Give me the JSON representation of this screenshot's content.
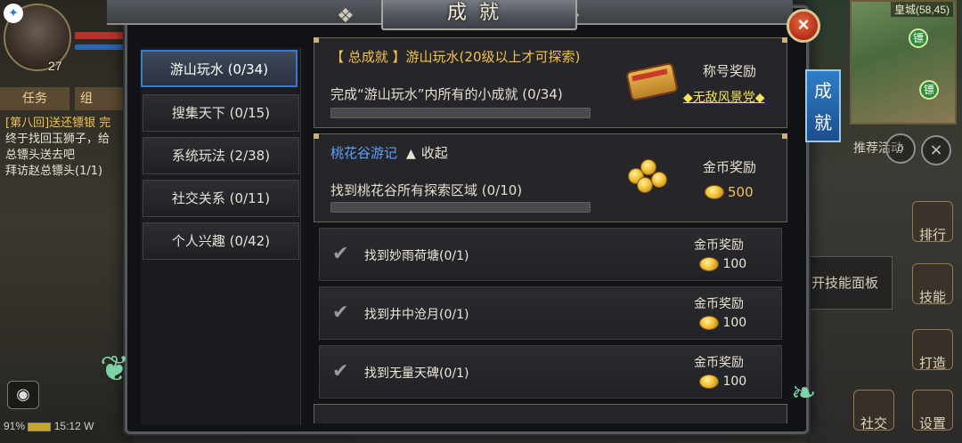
{
  "hud": {
    "level": "27",
    "notif_icon": "bird-badge-icon",
    "tabs": [
      "任务",
      "组"
    ],
    "quest_log": {
      "title": "[第八回]送还镖银 完",
      "lines": [
        "终于找回玉狮子，给",
        "总镖头送去吧",
        "拜访赵总镖头(1/1)"
      ]
    },
    "status": {
      "battery": "91%",
      "time": "15:12",
      "signal": "W"
    },
    "map_coords": "皇城(58,45)",
    "map_markers": [
      "镖",
      "镖"
    ],
    "recommend": "推荐活动",
    "side_buttons": [
      "排行",
      "技能",
      "打造",
      "社交",
      "设置"
    ],
    "skill_panel": "开技能面板"
  },
  "panel": {
    "title": "成就",
    "close_label": "×",
    "side_tab": "成就",
    "categories": [
      {
        "label": "游山玩水 (0/34)",
        "active": true
      },
      {
        "label": "搜集天下 (0/15)",
        "active": false
      },
      {
        "label": "系统玩法 (2/38)",
        "active": false
      },
      {
        "label": "社交关系 (0/11)",
        "active": false
      },
      {
        "label": "个人兴趣 (0/42)",
        "active": false
      }
    ],
    "total_card": {
      "tag": "【 总成就 】",
      "title": "游山玩水(20级以上才可探索)",
      "desc": "完成“游山玩水”内所有的小成就 (0/34)",
      "progress": 0,
      "reward_label": "称号奖励",
      "reward_title": "◆无敌风景党◆"
    },
    "group_card": {
      "name": "桃花谷游记",
      "collapse": "收起",
      "desc": "找到桃花谷所有探索区域 (0/10)",
      "progress": 0,
      "reward_label": "金币奖励",
      "reward_value": "500"
    },
    "rows": [
      {
        "name": "找到妙雨荷塘(0/1)",
        "reward_label": "金币奖励",
        "reward_value": "100"
      },
      {
        "name": "找到井中沧月(0/1)",
        "reward_label": "金币奖励",
        "reward_value": "100"
      },
      {
        "name": "找到无量天碑(0/1)",
        "reward_label": "金币奖励",
        "reward_value": "100"
      }
    ]
  }
}
